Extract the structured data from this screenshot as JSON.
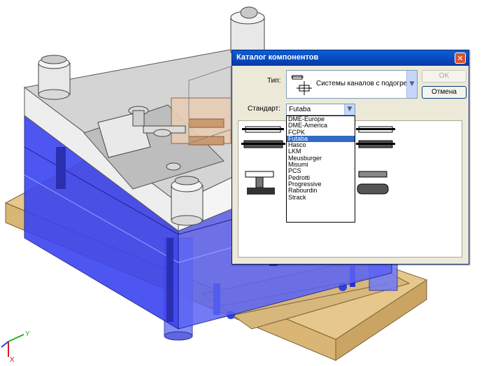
{
  "dialog": {
    "title": "Каталог компонентов",
    "close_icon": "close-icon",
    "type_label": "Тип:",
    "type_value": "Системы каналов с подогре",
    "ok_label": "OK",
    "cancel_label": "Отмена",
    "standard_label": "Стандарт:",
    "standard_value": "Futaba",
    "standard_options": [
      "DME-Europe",
      "DME-America",
      "FCPK",
      "Futaba",
      "Hasco",
      "LKM",
      "Meusburger",
      "Misumi",
      "PCS",
      "Pedrotti",
      "Progressive",
      "Rabourdin",
      "Strack"
    ],
    "selected_index": 3
  },
  "axes": {
    "y_label": "Y",
    "x_label": "X"
  },
  "colors": {
    "titlebar": "#0a5fd8",
    "selection": "#316ac5",
    "plate_blue": "#3a44f0",
    "wood": "#e3c58a"
  }
}
